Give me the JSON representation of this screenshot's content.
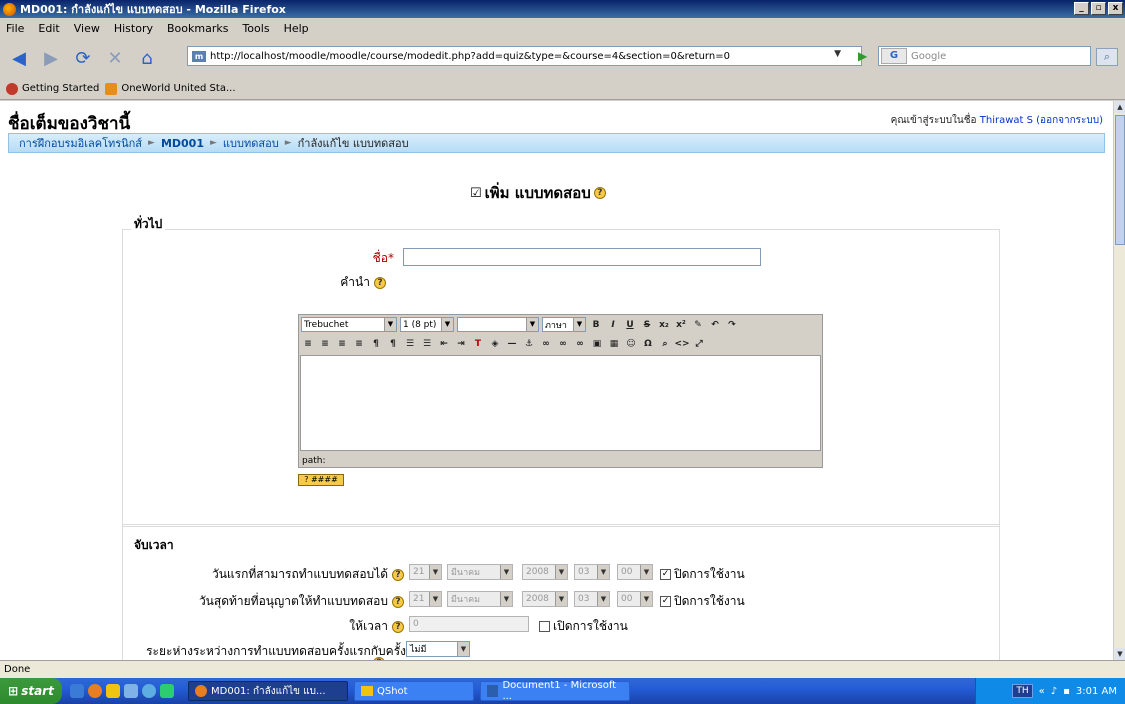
{
  "window": {
    "title": "MD001: กำลังแก้ไข แบบทดสอบ - Mozilla Firefox",
    "btn_min": "_",
    "btn_max": "▫",
    "btn_close": "x"
  },
  "menu": [
    "File",
    "Edit",
    "View",
    "History",
    "Bookmarks",
    "Tools",
    "Help"
  ],
  "url": "http://localhost/moodle/moodle/course/modedit.php?add=quiz&type=&course=4&section=0&return=0",
  "search_placeholder": "Google",
  "bookmarks": [
    "Getting Started",
    "OneWorld United Sta..."
  ],
  "page": {
    "site_title": "ชื่อเต็มของวิชานี้",
    "login_prefix": "คุณเข้าสู่ระบบในชื่อ",
    "login_user": "Thirawat S",
    "login_logout": "(ออกจากระบบ)",
    "breadcrumb": [
      "การฝึกอบรมอิเลคโทรนิกส์",
      "MD001",
      "แบบทดสอบ",
      "กำลังแก้ไข แบบทดสอบ"
    ],
    "heading": "เพิ่ม แบบทดสอบ",
    "general_legend": "ทั่วไป",
    "name_label": "ชื่อ",
    "intro_label": "คำนำ",
    "editor": {
      "font": "Trebuchet",
      "size": "1 (8 pt)",
      "lang": "ภาษา",
      "path": "path:"
    },
    "timing_legend": "จับเวลา",
    "open_label": "วันแรกที่สามารถทำแบบทดสอบได้",
    "close_label": "วันสุดท้ายที่อนุญาตให้ทำแบบทดสอบ",
    "date": {
      "day": "21",
      "month": "มีนาคม",
      "year": "2008",
      "hour": "03",
      "minute": "00"
    },
    "disable_label": "ปิดการใช้งาน",
    "timelimit_label": "ให้เวลา",
    "timelimit_value": "0",
    "enable_label": "เปิดการใช้งาน",
    "delay_label": "ระยะห่างระหว่างการทำแบบทดสอบครั้งแรกกับครั้ง",
    "delay_value": "ไม่มี"
  },
  "status": "Done",
  "taskbar": {
    "start": "start",
    "tasks": [
      "MD001: กำลังแก้ไข แบ...",
      "QShot",
      "Document1 - Microsoft ..."
    ],
    "lang": "TH",
    "time": "3:01 AM"
  }
}
